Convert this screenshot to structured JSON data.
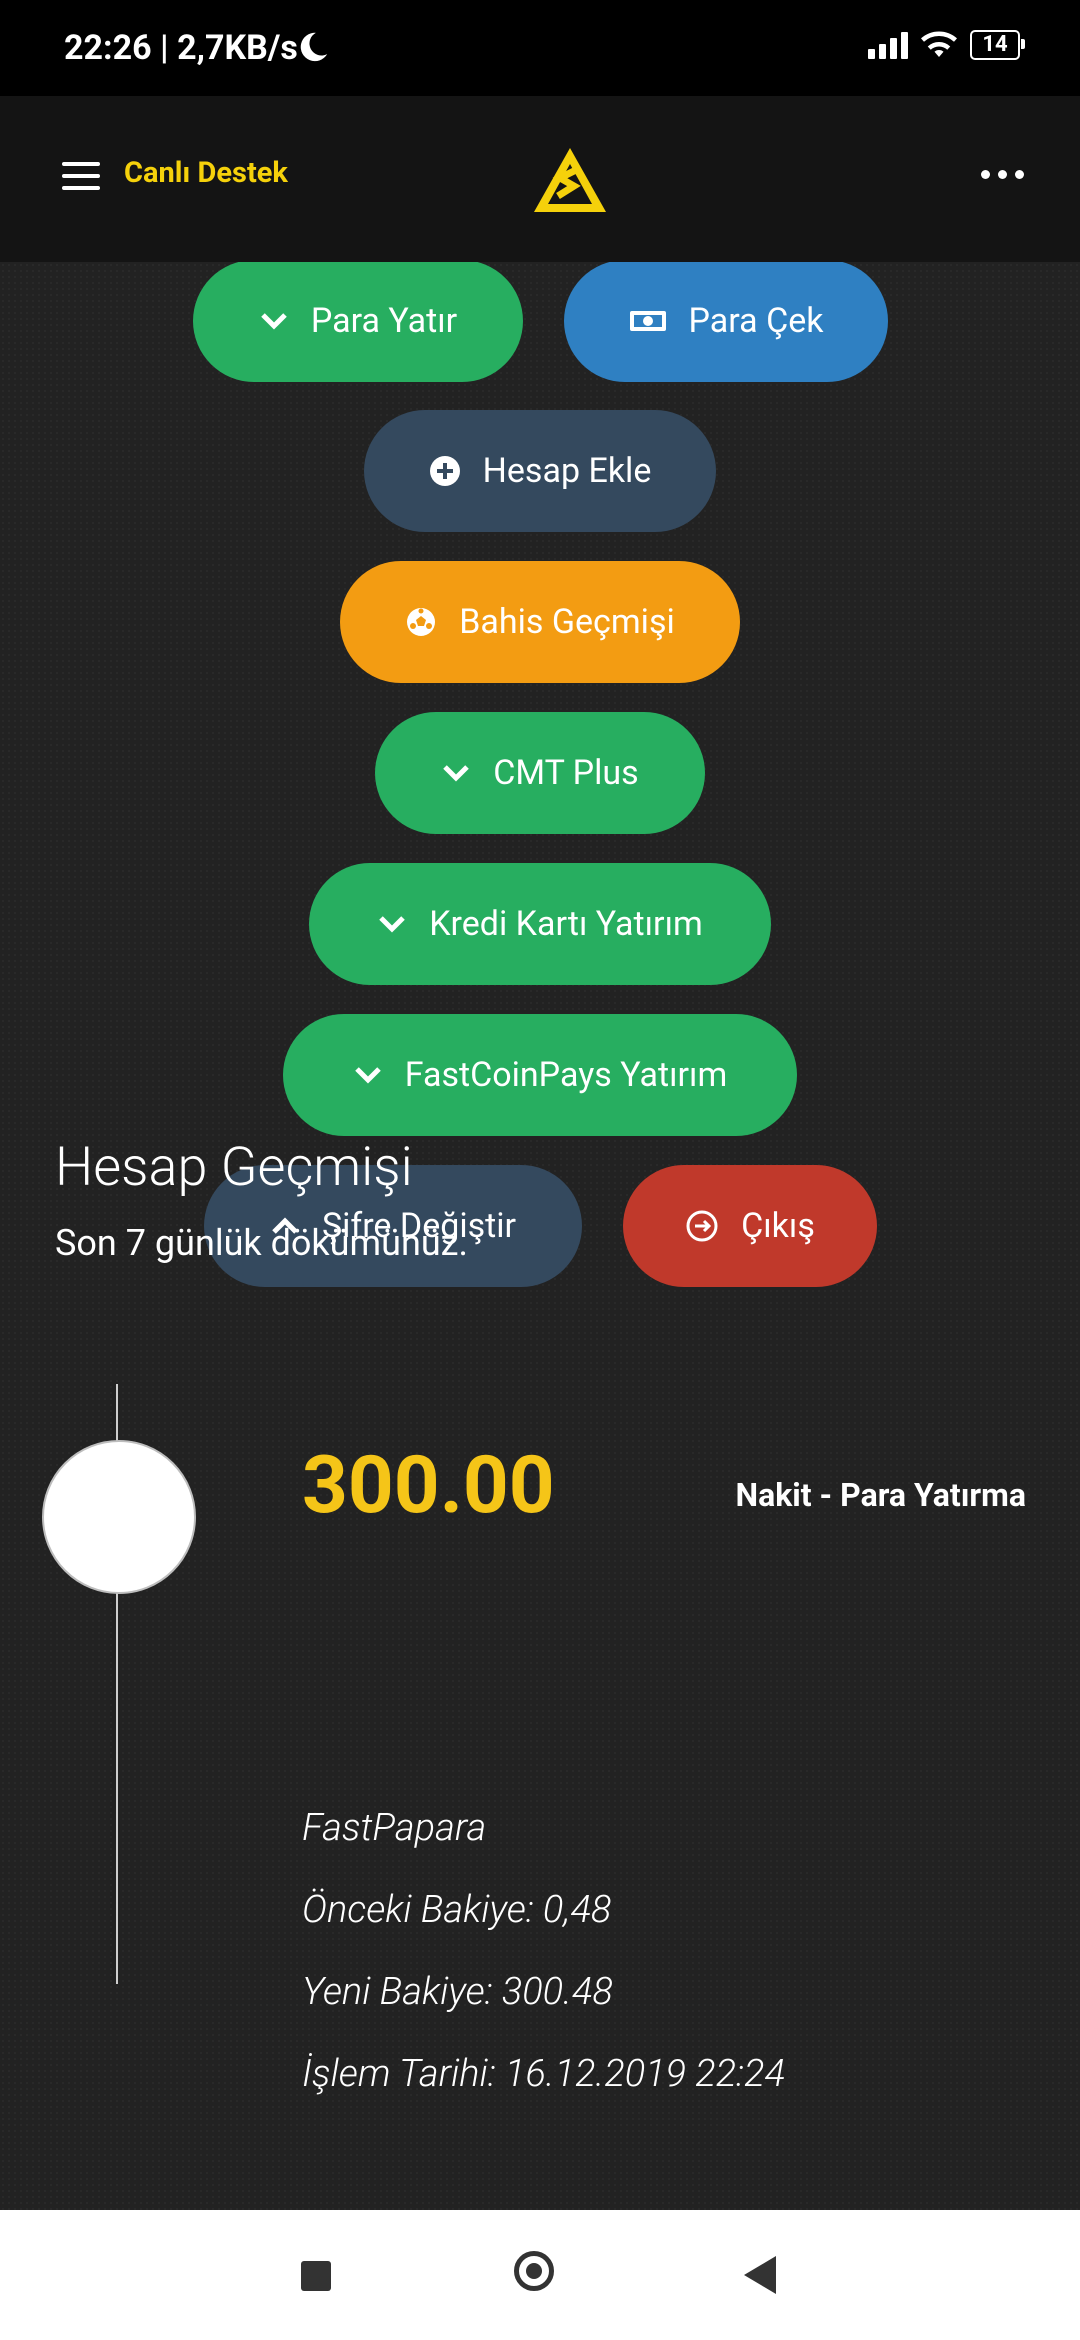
{
  "status_bar": {
    "time": "22:26 | 2,7KB/s",
    "battery": "14"
  },
  "header": {
    "live_support": "Canlı Destek",
    "logo_name": "site-logo"
  },
  "buttons": {
    "deposit": "Para Yatır",
    "withdraw": "Para Çek",
    "add_account": "Hesap Ekle",
    "bet_history": "Bahis Geçmişi",
    "cmt_plus": "CMT Plus",
    "credit_card_deposit": "Kredi Kartı Yatırım",
    "fastcoinpays_deposit": "FastCoinPays Yatırım",
    "change_password": "Şifre Değiştir",
    "logout": "Çıkış"
  },
  "colors": {
    "accent_yellow": "#f5d10b",
    "green": "#27ae60",
    "blue": "#2f80c2",
    "navy": "#34495e",
    "orange": "#f39c12",
    "red": "#c0392b",
    "amount_yellow": "#f5c518"
  },
  "history": {
    "title": "Hesap Geçmişi",
    "subtitle": "Son 7 günlük dökümünüz.",
    "transactions": [
      {
        "amount": "300.00",
        "type": "Nakit - Para Yatırma",
        "method": "FastPapara",
        "previous_balance": "Önceki Bakiye: 0,48",
        "new_balance": "Yeni Bakiye: 300.48",
        "date": "İşlem Tarihi: 16.12.2019 22:24"
      }
    ]
  }
}
